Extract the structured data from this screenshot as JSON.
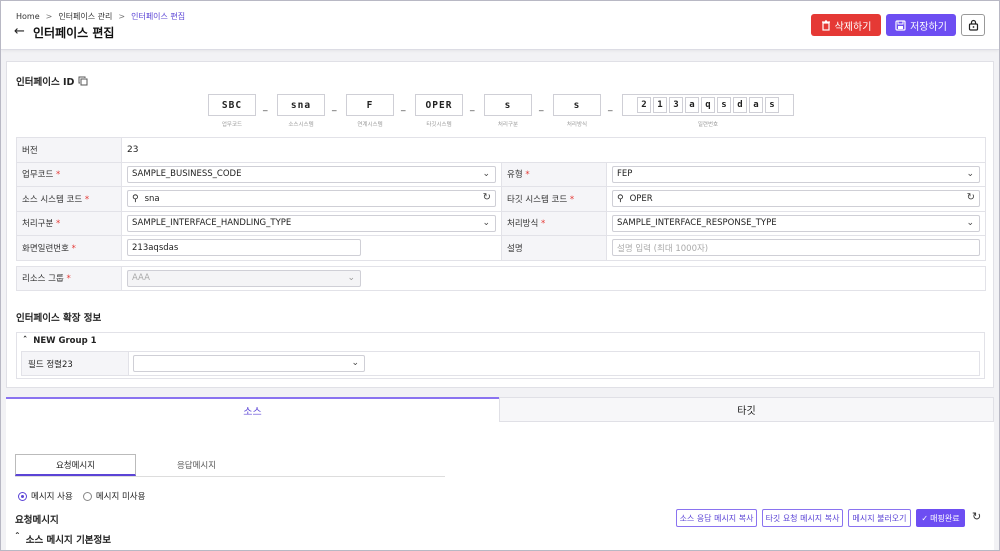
{
  "header": {
    "breadcrumb": [
      "Home",
      "인터페이스 관리",
      "인터페이스 편집"
    ],
    "title": "인터페이스 편집",
    "delete_label": "삭제하기",
    "save_label": "저장하기"
  },
  "interface_id": {
    "label": "인터페이스 ID",
    "segments": [
      {
        "value": "SBC",
        "caption": "업무코드"
      },
      {
        "value": "sna",
        "caption": "소스시스템"
      },
      {
        "value": "F",
        "caption": "연계시스템"
      },
      {
        "value": "OPER",
        "caption": "타깃시스템"
      },
      {
        "value": "s",
        "caption": "처리구분"
      },
      {
        "value": "s",
        "caption": "처리방식"
      }
    ],
    "serial_chars": [
      "2",
      "1",
      "3",
      "a",
      "q",
      "s",
      "d",
      "a",
      "s"
    ],
    "serial_caption": "일련번호"
  },
  "form": {
    "version_label": "버전",
    "version_value": "23",
    "business_code_label": "업무코드",
    "business_code_value": "SAMPLE_BUSINESS_CODE",
    "type_label": "유형",
    "type_value": "FEP",
    "source_system_label": "소스 시스템 코드",
    "source_system_value": "sna",
    "target_system_label": "타깃 시스템 코드",
    "target_system_value": "OPER",
    "handling_type_label": "처리구분",
    "handling_type_value": "SAMPLE_INTERFACE_HANDLING_TYPE",
    "response_type_label": "처리방식",
    "response_type_value": "SAMPLE_INTERFACE_RESPONSE_TYPE",
    "screen_serial_label": "화면일련번호",
    "screen_serial_value": "213aqsdas",
    "description_label": "설명",
    "description_placeholder": "설명 입력 (최대 1000자)",
    "resource_group_label": "리소스 그룹",
    "resource_group_value": "AAA",
    "required_mark": "*"
  },
  "extension": {
    "title": "인터페이스 확장 정보",
    "group_name": "NEW Group 1",
    "field_label": "필드 정렬23",
    "field_value": ""
  },
  "tabs": {
    "source": "소스",
    "target": "타깃"
  },
  "message": {
    "subtab_request": "요청메시지",
    "subtab_response": "응답메시지",
    "radio_use": "메시지 사용",
    "radio_unused": "메시지 미사용",
    "section_title": "요청메시지",
    "basic_info": "소스 메시지 기본정보",
    "btn_copy_source_response": "소스 응답 메시지 복사",
    "btn_copy_target_request": "타깃 요청 메시지 복사",
    "btn_load": "메시지 불러오기",
    "btn_mapping_done": "매핑완료"
  },
  "colors": {
    "accent": "#6d4ef2",
    "danger": "#e53935"
  }
}
